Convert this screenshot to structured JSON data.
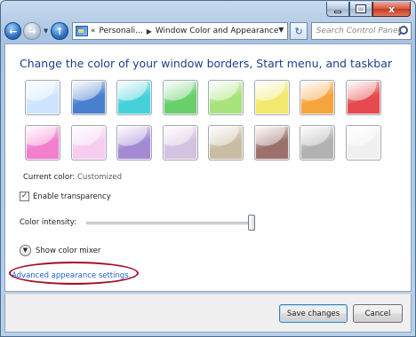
{
  "titlebar": {
    "minimize_icon": "minimize-icon",
    "maximize_icon": "maximize-icon",
    "close_icon": "close-icon",
    "close_glyph": "x"
  },
  "nav": {
    "back_glyph": "←",
    "forward_glyph": "→",
    "up_glyph": "↑",
    "breadcrumb_prefix": "«",
    "breadcrumb_parent": "Personali...",
    "breadcrumb_current": "Window Color and Appearance",
    "refresh_glyph": "↻",
    "search_placeholder": "Search Control Panel"
  },
  "page": {
    "heading": "Change the color of your window borders, Start menu, and taskbar",
    "swatches": [
      {
        "name": "sky",
        "color": "#cfe5ff"
      },
      {
        "name": "twilight",
        "color": "#4a7fd0"
      },
      {
        "name": "sea",
        "color": "#46d1d9"
      },
      {
        "name": "leaf",
        "color": "#68cf6a"
      },
      {
        "name": "lime",
        "color": "#a7e37b"
      },
      {
        "name": "lemon",
        "color": "#f2e86d"
      },
      {
        "name": "pumpkin",
        "color": "#f6a53d"
      },
      {
        "name": "ruby",
        "color": "#e64a4f"
      },
      {
        "name": "fuchsia",
        "color": "#f37fcf"
      },
      {
        "name": "blush",
        "color": "#f7cdef"
      },
      {
        "name": "violet",
        "color": "#a38ad3"
      },
      {
        "name": "lavender",
        "color": "#d3c2e0"
      },
      {
        "name": "taupe",
        "color": "#c8bda2"
      },
      {
        "name": "chocolate",
        "color": "#9c706b"
      },
      {
        "name": "slate",
        "color": "#b2b2b2"
      },
      {
        "name": "frost",
        "color": "#f0f0f0"
      }
    ],
    "current_color_label": "Current color:",
    "current_color_value": "Customized",
    "enable_transparency_label": "Enable transparency",
    "enable_transparency_checked": true,
    "color_intensity_label": "Color intensity:",
    "color_intensity_value": 1.0,
    "show_color_mixer_label": "Show color mixer",
    "advanced_link": "Advanced appearance settings..."
  },
  "footer": {
    "save_label": "Save changes",
    "cancel_label": "Cancel"
  },
  "colors": {
    "heading": "#1e3f8a",
    "link": "#1d62c4",
    "annotation": "#a0112a"
  }
}
